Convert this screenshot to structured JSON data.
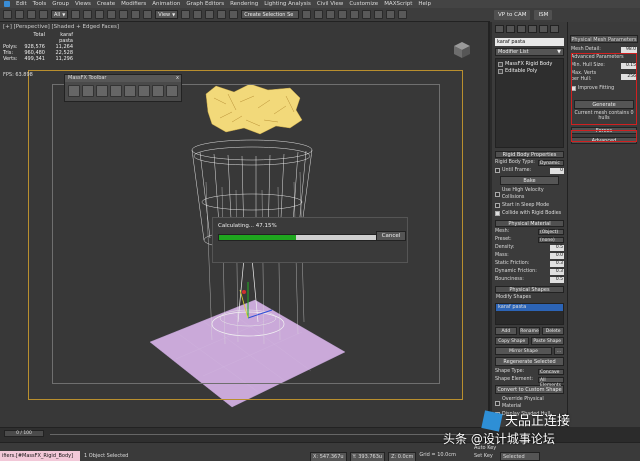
{
  "menubar": {
    "items": [
      "Edit",
      "Tools",
      "Group",
      "Views",
      "Create",
      "Modifiers",
      "Animation",
      "Graph Editors",
      "Rendering",
      "Lighting Analysis",
      "Civil View",
      "Customize",
      "MAXScript",
      "Help"
    ]
  },
  "toolbar": {
    "filter": "All",
    "view": "View",
    "selection_set": "Create Selection Se"
  },
  "tabs": [
    "VP to CAM",
    "ISM"
  ],
  "viewport": {
    "label": "[+] [Perspective] [Shaded + Edged Faces]",
    "stats_header": [
      "Total",
      "karaf pasta"
    ],
    "stats": [
      {
        "k": "Polys:",
        "a": "928,576",
        "b": "11,264"
      },
      {
        "k": "Tris:",
        "a": "960,480",
        "b": "22,528"
      },
      {
        "k": "Verts:",
        "a": "499,341",
        "b": "11,296"
      }
    ],
    "fps": "FPS:   63.898"
  },
  "massfx_toolbar": {
    "title": "MassFX Toolbar",
    "close": "x"
  },
  "progress": {
    "label": "Calculating... 47.15%",
    "fraction": 0.4715,
    "cancel": "Cancel"
  },
  "command_panel": {
    "object_name": "karaf pasta",
    "modifier_list": "Modifier List",
    "stack": [
      "MassFX Rigid Body",
      "Editable Poly"
    ],
    "rigid_body": {
      "title": "Rigid Body Properties",
      "type_label": "Rigid Body Type:",
      "type_value": "Dynamic",
      "until_frame": "Until Frame:",
      "until_value": "0",
      "bake": "Bake",
      "checks": [
        {
          "label": "Use High Velocity Collisions",
          "on": false
        },
        {
          "label": "Start in Sleep Mode",
          "on": false
        },
        {
          "label": "Collide with Rigid Bodies",
          "on": true
        }
      ]
    },
    "material": {
      "title": "Physical Material",
      "mesh_label": "Mesh:",
      "mesh_value": "(Object)",
      "preset_label": "Preset:",
      "preset_value": "(none)",
      "props": [
        {
          "k": "Density:",
          "v": "0.5"
        },
        {
          "k": "Mass:",
          "v": "0.0"
        },
        {
          "k": "Static Friction:",
          "v": "0.3"
        },
        {
          "k": "Dynamic Friction:",
          "v": "0.3"
        },
        {
          "k": "Bounciness:",
          "v": "0.5"
        }
      ]
    },
    "shapes": {
      "title": "Physical Shapes",
      "modify": "Modify Shapes",
      "selected": "karaf pasta",
      "add": "Add",
      "rename": "Rename",
      "delete": "Delete",
      "copy_shape": "Copy Shape",
      "paste_shape": "Paste Shape",
      "mirror_shape": "Mirror Shape",
      "regenerate": "Regenerate Selected",
      "shape_type_label": "Shape Type:",
      "shape_type": "Concave",
      "shape_element_label": "Shape Element:",
      "shape_element": "All Elements",
      "convert": "Convert to Custom Shape",
      "override": "Override Physical Material",
      "display_hull": "Display Shaded Hull"
    }
  },
  "mesh_panel": {
    "title": "Physical Mesh Parameters",
    "mesh_detail_label": "Mesh Detail:",
    "mesh_detail_value": "98.0",
    "advanced": "Advanced Parameters",
    "min_hull_label": "Min. Hull Size:",
    "min_hull_value": "0.15",
    "max_verts_label": "Max. Verts per Hull:",
    "max_verts_value": "256",
    "improve": "Improve Fitting",
    "generate": "Generate",
    "status": "Current mesh contains 0 hulls",
    "forces": "Forces",
    "adv": "Advanced"
  },
  "timeline": {
    "frame": "0 / 100"
  },
  "statusbar": {
    "script": "ifiers.[#MassFX_Rigid_Body]",
    "selected": "1 Object Selected",
    "x": "X: 547.367u",
    "y": "Y: 393.763u",
    "z": "Z: 0.0cm",
    "grid": "Grid = 10.0cm",
    "autokey": "Auto Key",
    "setkey": "Set Key",
    "key_mode": "Selected"
  },
  "watermark": {
    "line1": "头条 @",
    "line2": "设计城事论坛",
    "top": "天品正连接"
  },
  "colors": {
    "selection": "#d02020",
    "progress": "#1ea61e",
    "pasta": "#f0d777",
    "plane": "#c8a8d8",
    "safe_frame": "#b98f2e"
  }
}
